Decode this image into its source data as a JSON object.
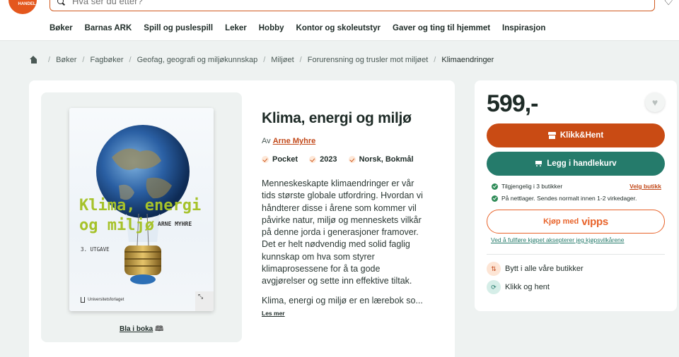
{
  "header": {
    "logo_text": "BOK\nHANDEL",
    "search_placeholder": "Hva ser du etter?",
    "nav": [
      "Bøker",
      "Barnas ARK",
      "Spill og puslespill",
      "Leker",
      "Hobby",
      "Kontor og skoleutstyr",
      "Gaver og ting til hjemmet",
      "Inspirasjon"
    ]
  },
  "breadcrumb": [
    "Bøker",
    "Fagbøker",
    "Geofag, geografi og miljøkunnskap",
    "Miljøet",
    "Forurensning og trusler mot miljøet",
    "Klimaendringer"
  ],
  "book": {
    "cover_title": "Klima, energi og miljø",
    "cover_author": "ARNE MYHRE",
    "cover_edition": "3. UTGAVE",
    "cover_publisher": "Universitetsforlaget",
    "read_in_book": "Bla i boka",
    "title": "Klima, energi og miljø",
    "by_label": "Av",
    "author": "Arne Myhre",
    "format": "Pocket",
    "year": "2023",
    "language": "Norsk, Bokmål",
    "description": "Menneskeskapte klimaendringer er vår tids største globale utfordring. Hvordan vi håndterer disse i årene som kommer vil påvirke natur, miljø og menneskets vilkår på denne jorda i generasjoner framover. Det er helt nødvendig med solid faglig kunnskap om hva som styrer klimaprosessene for å ta gode avgjørelser og sette inn effektive tiltak.",
    "description_more": "Klima, energi og miljø er en lærebok so...",
    "read_more": "Les mer"
  },
  "buy": {
    "price": "599,-",
    "click_collect": "Klikk&Hent",
    "add_to_cart": "Legg i handlekurv",
    "availability_stores": "Tilgjengelig i 3 butikker",
    "choose_store": "Velg butikk",
    "availability_online": "På nettlager. Sendes normalt innen 1-2 virkedager.",
    "vipps_prefix": "Kjøp med",
    "vipps_brand": "vipps",
    "terms": "Ved å fullføre kjøpet aksepterer jeg kjøpsvilkårene",
    "perk_exchange": "Bytt i alle våre butikker",
    "perk_pickup": "Klikk og hent"
  },
  "colors": {
    "accent_orange": "#c94b14",
    "accent_green": "#257b6b",
    "page_bg": "#eef2f1"
  }
}
